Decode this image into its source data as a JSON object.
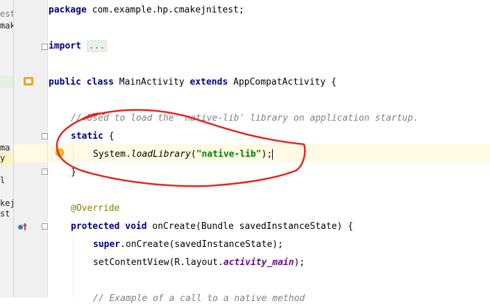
{
  "project_panel": {
    "fragments": [
      "est",
      "mak",
      "ma",
      "y",
      "l",
      "kej",
      "st"
    ]
  },
  "editor": {
    "lines": {
      "package": {
        "kw": "package",
        "rest": " com.example.hp.cmakejnitest;"
      },
      "import": {
        "kw": "import",
        "folded": "..."
      },
      "class_decl": {
        "kw1": "public class",
        "name": " MainActivity ",
        "kw2": "extends",
        "rest": " AppCompatActivity {"
      },
      "comment1": "// Used to load the 'native-lib' library on application startup.",
      "static_block": {
        "kw": "static",
        "rest": " {"
      },
      "load_library": {
        "pre": "System.",
        "method": "loadLibrary",
        "open": "(",
        "arg": "\"native-lib\"",
        "close": ");"
      },
      "close_static": "}",
      "override": "@Override",
      "oncreate": {
        "kw": "protected void",
        "rest": " onCreate(Bundle savedInstanceState) {"
      },
      "super_call": {
        "kw": "super",
        "rest": ".onCreate(savedInstanceState);"
      },
      "set_content": {
        "pre": "setContentView(R.layout.",
        "field": "activity_main",
        "post": ");"
      },
      "comment2": "// Example of a call to a native method"
    }
  },
  "colors": {
    "keyword": "#000080",
    "string": "#008000",
    "comment": "#808080",
    "annotation": "#808000",
    "field": "#660e7a",
    "current_line": "#fffae3",
    "annotation_circle": "#e8231f"
  }
}
